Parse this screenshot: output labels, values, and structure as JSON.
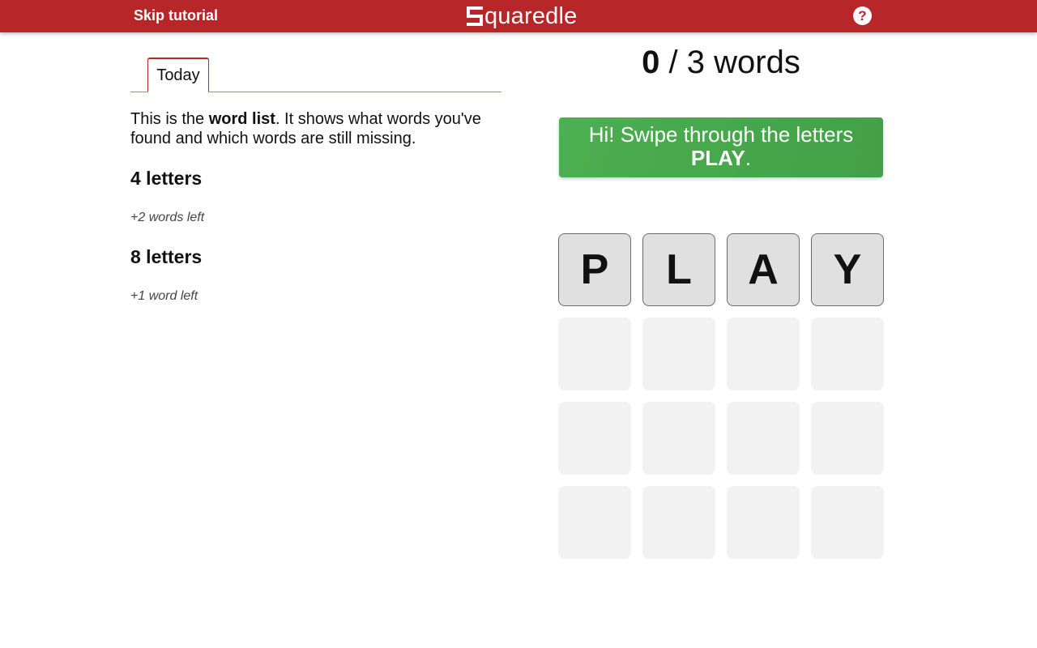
{
  "header": {
    "skip_label": "Skip tutorial",
    "logo_text": "quaredle",
    "help_label": "?",
    "brand_color": "#b72629"
  },
  "word_list": {
    "tab_label": "Today",
    "intro_pre": "This is the ",
    "intro_bold": "word list",
    "intro_post": ". It shows what words you've found and which words are still missing.",
    "sections": [
      {
        "title": "4 letters",
        "remaining": "+2 words left"
      },
      {
        "title": "8 letters",
        "remaining": "+1 word left"
      }
    ]
  },
  "progress": {
    "found": "0",
    "separator": "/",
    "total_text": "3 words"
  },
  "tutorial": {
    "message": "Hi! Swipe through the letters",
    "word": "PLAY",
    "suffix": ".",
    "color": "#4caf50"
  },
  "board": {
    "rows": [
      [
        "P",
        "L",
        "A",
        "Y"
      ],
      [
        "",
        "",
        "",
        ""
      ],
      [
        "",
        "",
        "",
        ""
      ],
      [
        "",
        "",
        "",
        ""
      ]
    ]
  },
  "icons": {
    "help": "question-circle-icon",
    "logo": "squaredle-s-icon"
  }
}
